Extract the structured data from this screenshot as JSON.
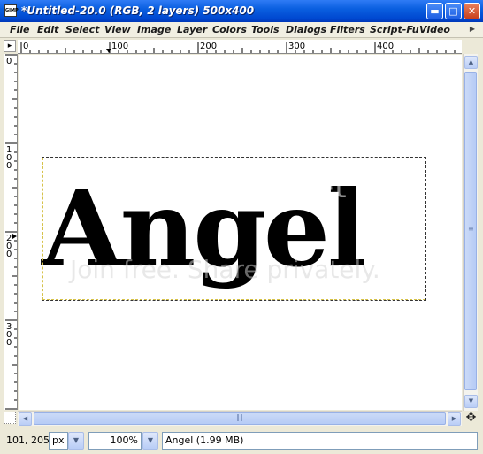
{
  "window": {
    "title": "*Untitled-20.0 (RGB, 2 layers) 500x400",
    "app_icon": "wilber",
    "minimize_icon": "minimize-icon",
    "maximize_icon": "maximize-icon",
    "close_icon": "close-icon"
  },
  "menubar": {
    "items": [
      "File",
      "Edit",
      "Select",
      "View",
      "Image",
      "Layer",
      "Colors",
      "Tools",
      "Dialogs",
      "Filters",
      "Script-Fu",
      "Video"
    ]
  },
  "rulers": {
    "horizontal_ticks": [
      "0",
      "100",
      "200",
      "300",
      "400"
    ],
    "vertical_ticks": [
      "0",
      "100",
      "200",
      "300"
    ]
  },
  "canvas": {
    "image_text": "Angel",
    "watermark_logo": "photobucket",
    "watermark_tag": "Join free. Share privately."
  },
  "statusbar": {
    "coords": "101, 205",
    "unit": "px",
    "zoom": "100%",
    "message": "Angel (1.99 MB)"
  },
  "colors": {
    "titlebar": "#0a5fe0",
    "close_button": "#c8401d",
    "canvas": "#ffffff"
  }
}
